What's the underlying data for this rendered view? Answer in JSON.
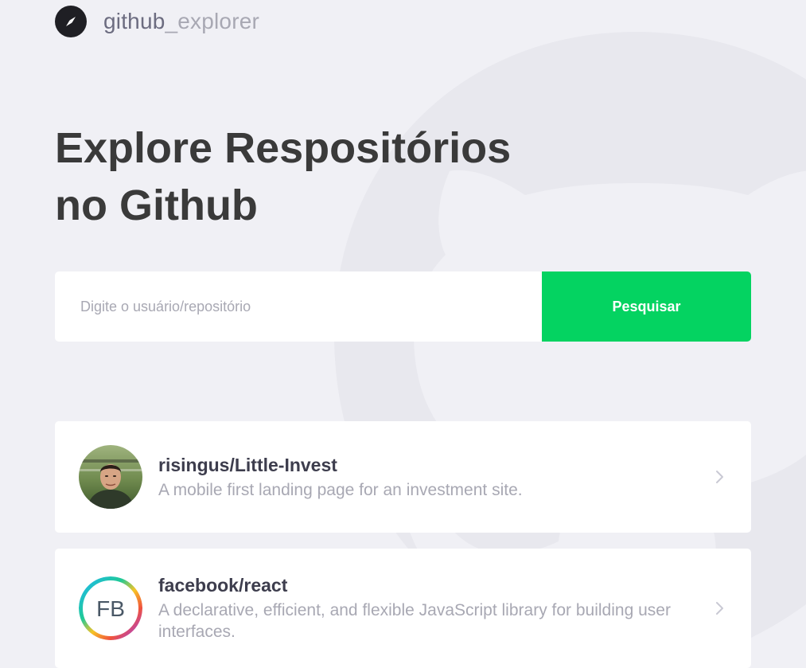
{
  "header": {
    "logo_icon": "compass-icon",
    "app_name_part1": "github",
    "app_name_part2": "_explorer"
  },
  "title": {
    "line1": "Explore Respositórios",
    "line2": "no Github"
  },
  "search": {
    "placeholder": "Digite o usuário/repositório",
    "value": "",
    "button_label": "Pesquisar"
  },
  "repositories": [
    {
      "full_name": "risingus/Little-Invest",
      "description": "A mobile first landing page for an investment site.",
      "avatar": "user-photo-avatar"
    },
    {
      "full_name": "facebook/react",
      "description": "A declarative, efficient, and flexible JavaScript library for building user interfaces.",
      "avatar": "fb-logo-avatar",
      "avatar_text": "FB"
    }
  ],
  "colors": {
    "background": "#f0f0f5",
    "accent": "#04d361",
    "title": "#3a3a3a",
    "muted": "#a8a8b3"
  }
}
